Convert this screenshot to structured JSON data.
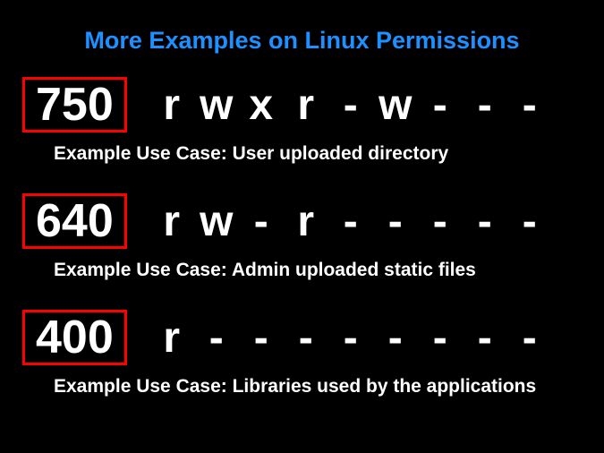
{
  "title": "More Examples on Linux Permissions",
  "examples": [
    {
      "octal": "750",
      "perm0": "r",
      "perm1": "w",
      "perm2": "x",
      "perm3": "r",
      "perm4": "-",
      "perm5": "w",
      "perm6": "-",
      "perm7": "-",
      "perm8": "-",
      "use_case": "Example Use Case: User uploaded directory"
    },
    {
      "octal": "640",
      "perm0": "r",
      "perm1": "w",
      "perm2": "-",
      "perm3": "r",
      "perm4": "-",
      "perm5": "-",
      "perm6": "-",
      "perm7": "-",
      "perm8": "-",
      "use_case": "Example Use Case: Admin uploaded static files"
    },
    {
      "octal": "400",
      "perm0": "r",
      "perm1": "-",
      "perm2": "-",
      "perm3": "-",
      "perm4": "-",
      "perm5": "-",
      "perm6": "-",
      "perm7": "-",
      "perm8": "-",
      "use_case": "Example Use Case: Libraries used by the applications"
    }
  ]
}
